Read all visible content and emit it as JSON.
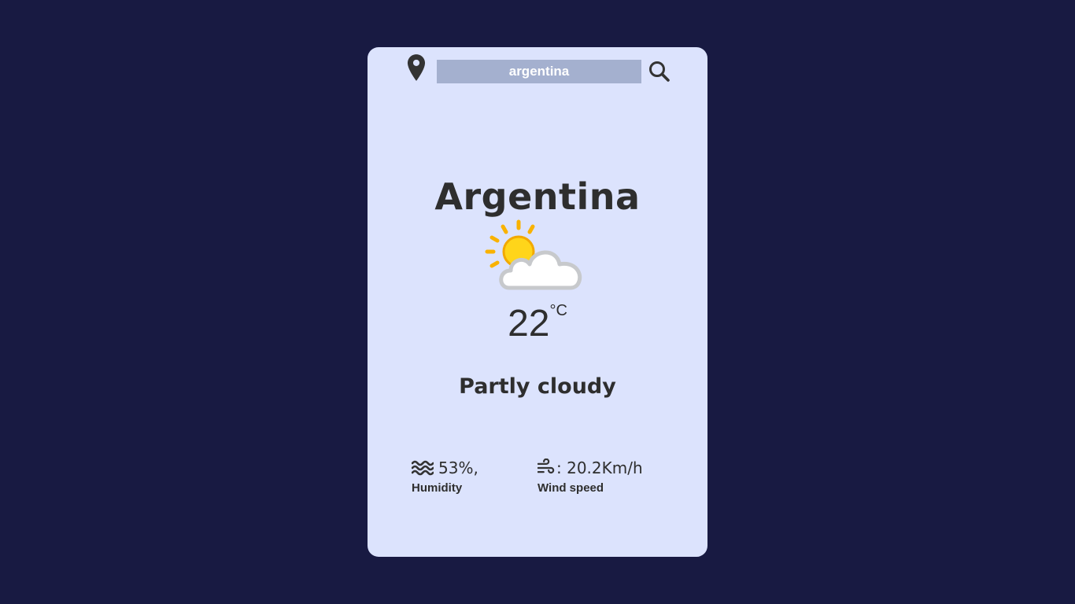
{
  "search": {
    "value": "argentina",
    "icon": "search-icon",
    "location_icon": "map-pin-icon"
  },
  "weather": {
    "city": "Argentina",
    "icon": "partly-cloudy-icon",
    "temperature": "22",
    "unit": "°C",
    "condition": "Partly cloudy"
  },
  "stats": {
    "humidity_value": "53%,",
    "humidity_label": "Humidity",
    "humidity_icon": "water-waves-icon",
    "wind_value": ": 20.2Km/h",
    "wind_label": "Wind speed",
    "wind_icon": "wind-icon"
  },
  "colors": {
    "background": "#181a42",
    "card": "#dce3fd",
    "input": "#a4b0cf",
    "text": "#2e2e2e"
  }
}
